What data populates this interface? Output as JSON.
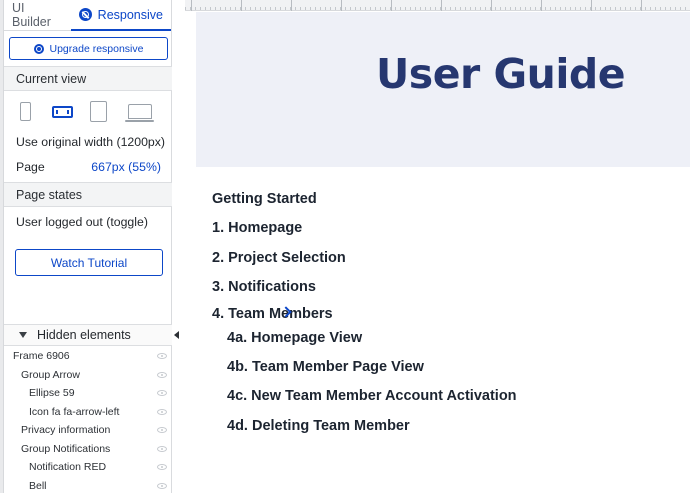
{
  "tabs": {
    "builder": "UI Builder",
    "responsive": "Responsive"
  },
  "upgrade_label": "Upgrade responsive",
  "current_view": {
    "header": "Current view",
    "devices": [
      "phone-portrait-icon",
      "phone-landscape-icon",
      "tablet-icon",
      "desktop-icon"
    ],
    "selected_device": "phone-landscape-icon",
    "use_original": "Use original width (1200px)",
    "page_label": "Page",
    "page_value": "667px (55%)"
  },
  "page_states": {
    "header": "Page states",
    "item": "User logged out (toggle)"
  },
  "watch_tutorial": "Watch Tutorial",
  "hidden": {
    "header": "Hidden elements",
    "items": [
      {
        "label": "Frame 6906",
        "level": 0
      },
      {
        "label": "Group Arrow",
        "level": 1
      },
      {
        "label": "Ellipse 59",
        "level": 2
      },
      {
        "label": "Icon fa fa-arrow-left",
        "level": 2
      },
      {
        "label": "Privacy information",
        "level": 1
      },
      {
        "label": "Group Notifications",
        "level": 1
      },
      {
        "label": "Notification RED",
        "level": 2
      },
      {
        "label": "Bell",
        "level": 2
      }
    ]
  },
  "canvas": {
    "title": "User Guide",
    "getting_started": "Getting Started",
    "items": [
      "1. Homepage",
      "2. Project Selection",
      "3. Notifications",
      "4. Team Members"
    ],
    "sub_items": [
      "4a. Homepage View",
      "4b. Team Member Page View",
      "4c. New Team Member Account Activation",
      "4d. Deleting Team Member"
    ]
  },
  "colors": {
    "accent": "#0d47c8",
    "title": "#263770",
    "hero_bg": "#eef0f7"
  }
}
